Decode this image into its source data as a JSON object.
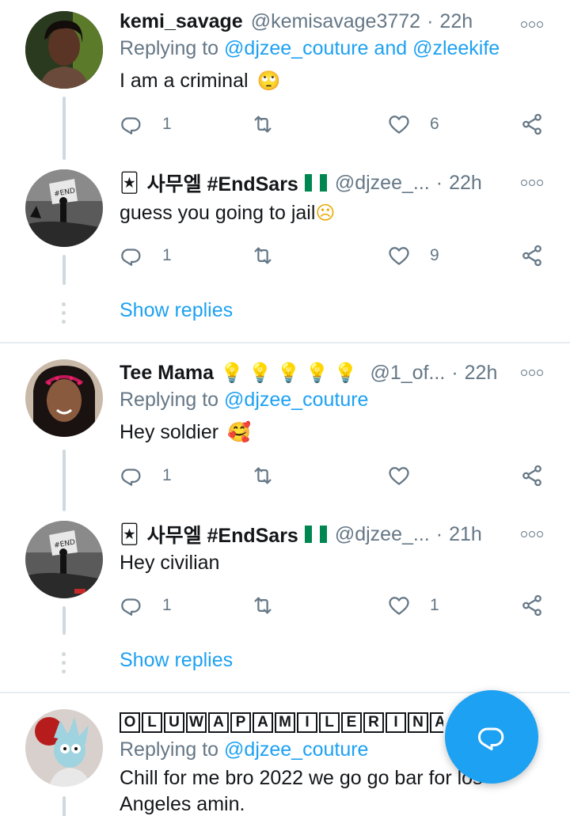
{
  "tweets": [
    {
      "name": "kemi_savage",
      "handle": "@kemisavage3772",
      "time": "22h",
      "reply_prefix": "Replying to ",
      "reply_users": "@djzee_couture and @zleekife",
      "text": "I am a criminal",
      "emoji": "🙄",
      "replies": "1",
      "retweets": "",
      "likes": "6"
    },
    {
      "name": "사무엘 #EndSars",
      "name_emoji": "🃏",
      "handle": "@djzee_...",
      "time": "22h",
      "text": "guess you going to jail",
      "emoji": "☹",
      "replies": "1",
      "retweets": "",
      "likes": "9"
    },
    {
      "name": "Tee Mama",
      "name_emojis": "💡💡💡💡💡",
      "handle": "@1_of...",
      "time": "22h",
      "reply_prefix": "Replying to ",
      "reply_users": "@djzee_couture",
      "text": "Hey soldier",
      "emoji": "🥰",
      "replies": "1",
      "retweets": "",
      "likes": ""
    },
    {
      "name": "사무엘 #EndSars",
      "name_emoji": "🃏",
      "handle": "@djzee_...",
      "time": "21h",
      "text": "Hey civilian",
      "replies": "1",
      "retweets": "",
      "likes": "1"
    },
    {
      "name_letters": [
        "O",
        "L",
        "U",
        "W",
        "A",
        "P",
        "A",
        "M",
        "I",
        "L",
        "E",
        "R",
        "I",
        "N",
        "A"
      ],
      "name_suffix": "...",
      "reply_prefix": "Replying to ",
      "reply_users": "@djzee_couture",
      "text_line1": "Chill for me bro 2022 we go go bar for los",
      "text_line2": "Angeles amin."
    }
  ],
  "show_replies_label": "Show replies",
  "separator": "·",
  "colors": {
    "accent": "#1da1f2",
    "secondary_text": "#657786",
    "divider": "#e6ecf0",
    "flag_green": "#008751",
    "flag_white": "#ffffff"
  },
  "icons": {
    "reply": "reply-icon",
    "retweet": "retweet-icon",
    "like": "like-icon",
    "share": "share-icon",
    "more": "more-icon",
    "compose": "compose-reply-icon"
  }
}
